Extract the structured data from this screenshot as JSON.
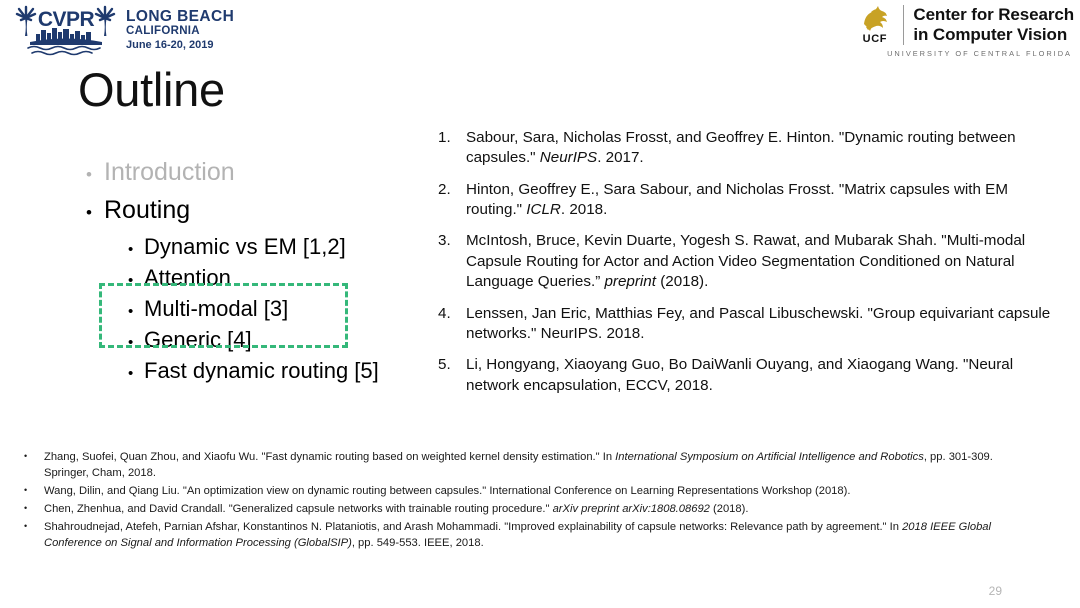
{
  "header": {
    "cvpr": {
      "logo_icon": "cvpr-palm-skyline-logo",
      "wordmark": "CVPR",
      "line1": "LONG BEACH",
      "line2": "CALIFORNIA",
      "line3": "June 16-20, 2019",
      "color": "#1f3a6e"
    },
    "ucf": {
      "mark_icon": "ucf-pegasus-icon",
      "mark_color": "#c8a225",
      "abbrev": "UCF",
      "name_line1": "Center for Research",
      "name_line2": "in Computer Vision",
      "tagline": "UNIVERSITY OF CENTRAL FLORIDA"
    }
  },
  "title": "Outline",
  "outline": {
    "items": [
      {
        "label": "Introduction",
        "level": 1,
        "state": "dim"
      },
      {
        "label": "Routing",
        "level": 1,
        "state": "active"
      },
      {
        "label": "Dynamic vs EM [1,2]",
        "level": 2,
        "state": "normal"
      },
      {
        "label": "Attention",
        "level": 2,
        "state": "highlighted"
      },
      {
        "label": "Multi-modal [3]",
        "level": 2,
        "state": "highlighted"
      },
      {
        "label": "Generic [4]",
        "level": 2,
        "state": "normal"
      },
      {
        "label": "Fast dynamic routing [5]",
        "level": 2,
        "state": "normal"
      }
    ],
    "highlight_color": "#35b87a",
    "bullet_glyph": "•"
  },
  "references": [
    {
      "number": "1.",
      "parts": [
        {
          "text": "Sabour, Sara, Nicholas Frosst, and Geoffrey E. Hinton. \"Dynamic routing between capsules.\" ",
          "italic": false
        },
        {
          "text": "NeurIPS",
          "italic": true
        },
        {
          "text": ". 2017.",
          "italic": false
        }
      ]
    },
    {
      "number": "2.",
      "parts": [
        {
          "text": "Hinton, Geoffrey E., Sara Sabour, and Nicholas Frosst. \"Matrix capsules with EM routing.\" ",
          "italic": false
        },
        {
          "text": "ICLR",
          "italic": true
        },
        {
          "text": ". 2018.",
          "italic": false
        }
      ]
    },
    {
      "number": "3.",
      "parts": [
        {
          "text": "McIntosh, Bruce, Kevin Duarte, Yogesh S. Rawat, and Mubarak Shah. \"Multi-modal Capsule Routing for Actor and Action Video Segmentation Conditioned on Natural Language Queries.” ",
          "italic": false
        },
        {
          "text": "preprint",
          "italic": true
        },
        {
          "text": " (2018).",
          "italic": false
        }
      ]
    },
    {
      "number": "4.",
      "parts": [
        {
          "text": "Lenssen, Jan Eric, Matthias Fey, and Pascal Libuschewski. \"Group equivariant capsule networks.\" NeurIPS. 2018.",
          "italic": false
        }
      ]
    },
    {
      "number": "5.",
      "parts": [
        {
          "text": "Li, Hongyang, Xiaoyang Guo, Bo DaiWanli Ouyang, and Xiaogang Wang. \"Neural network encapsulation, ECCV, 2018.",
          "italic": false
        }
      ]
    }
  ],
  "footnotes": [
    {
      "parts": [
        {
          "text": "Zhang, Suofei, Quan Zhou, and Xiaofu Wu. \"Fast dynamic routing based on weighted kernel density estimation.\" In ",
          "italic": false
        },
        {
          "text": "International Symposium on Artificial Intelligence and Robotics",
          "italic": true
        },
        {
          "text": ", pp. 301-309. Springer, Cham, 2018.",
          "italic": false
        }
      ]
    },
    {
      "parts": [
        {
          "text": "Wang, Dilin, and Qiang Liu. \"An optimization view on dynamic routing between capsules.\" International Conference on Learning Representations Workshop (2018).",
          "italic": false
        }
      ]
    },
    {
      "parts": [
        {
          "text": "Chen, Zhenhua, and David Crandall. \"Generalized capsule networks with trainable routing procedure.\" ",
          "italic": false
        },
        {
          "text": "arXiv preprint arXiv:1808.08692",
          "italic": true
        },
        {
          "text": " (2018).",
          "italic": false
        }
      ]
    },
    {
      "parts": [
        {
          "text": "Shahroudnejad, Atefeh, Parnian Afshar, Konstantinos N. Plataniotis, and Arash Mohammadi. \"Improved explainability of capsule networks: Relevance path by agreement.\" In ",
          "italic": false
        },
        {
          "text": "2018 IEEE Global Conference on Signal and Information Processing (GlobalSIP)",
          "italic": true
        },
        {
          "text": ", pp. 549-553. IEEE, 2018.",
          "italic": false
        }
      ]
    }
  ],
  "page_number": "29"
}
